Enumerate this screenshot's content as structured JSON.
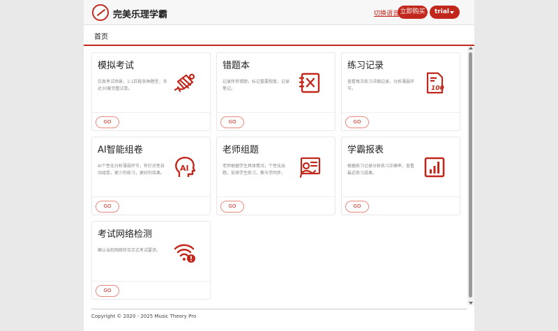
{
  "header": {
    "brand": "完美乐理学霸",
    "lang_link": "切换语言",
    "buy_label": "立即购买",
    "user_label": "trial"
  },
  "breadcrumb": "首页",
  "colors": {
    "accent": "#c1271b",
    "go_border": "#e8897e",
    "page_bg": "#e9e9e9"
  },
  "cards": [
    {
      "title": "模拟考试",
      "desc": "仿真考试场景，1:1匹配各种题型，多达30套完整试卷。",
      "icon": "diploma-scroll-icon",
      "go": "GO"
    },
    {
      "title": "错题本",
      "desc": "记录所有错题，标记重要程度，记录笔记。",
      "icon": "wrong-answer-book-icon",
      "go": "GO"
    },
    {
      "title": "练习记录",
      "desc": "查看每次练习详细记录，分析薄弱环节。",
      "icon": "score-100-icon",
      "go": "GO"
    },
    {
      "title": "AI智能组卷",
      "desc": "AI个性化分析薄弱环节，有针对性自动组卷，更少的练习，更好的效果。",
      "icon": "ai-head-icon",
      "go": "GO"
    },
    {
      "title": "老师组题",
      "desc": "老师根据学生具体情况，个性化出题，安排学生练习，教与学同步。",
      "icon": "teacher-board-icon",
      "go": "GO"
    },
    {
      "title": "学霸报表",
      "desc": "根据练习记录分析练习正确率，查看最近练习成果。",
      "icon": "bar-chart-icon",
      "go": "GO"
    },
    {
      "title": "考试网络检测",
      "desc": "确认当前网络符合正式考试要求。",
      "icon": "wifi-warning-icon",
      "go": "GO"
    }
  ],
  "footer": {
    "copyright": "Copyright © 2020 - 2025 Music Theory Pro"
  }
}
